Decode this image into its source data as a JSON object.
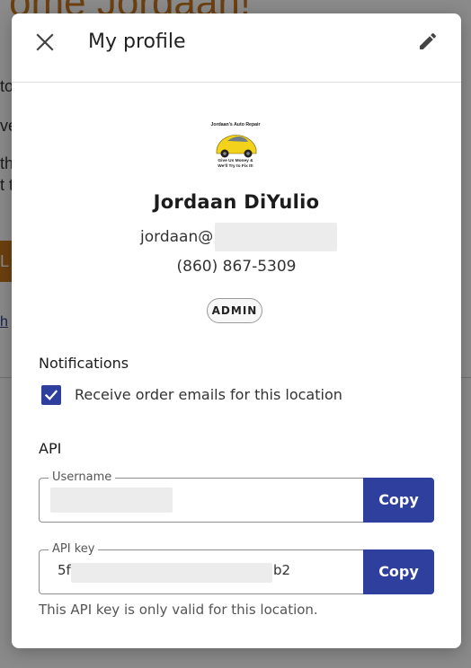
{
  "background": {
    "title": "ome Jordaan!",
    "lines": [
      "to",
      "ve",
      "th",
      "t t"
    ],
    "button_text": "L",
    "link_text": "h"
  },
  "modal": {
    "title": "My profile",
    "close_icon": "close-icon",
    "edit_icon": "pencil-icon"
  },
  "profile": {
    "logo": {
      "line1": "Jordaan's Auto Repair",
      "line2": "Give Us Money &",
      "line3": "We'll Try to Fix It!"
    },
    "name": "Jordaan DiYulio",
    "email_prefix": "jordaan@",
    "phone": "(860) 867-5309",
    "role_badge": "ADMIN"
  },
  "notifications": {
    "heading": "Notifications",
    "order_emails_label": "Receive order emails for this location",
    "order_emails_checked": true
  },
  "api": {
    "heading": "API",
    "username": {
      "label": "Username",
      "copy_label": "Copy"
    },
    "api_key": {
      "label": "API key",
      "prefix": "5f",
      "suffix": "b2",
      "copy_label": "Copy"
    },
    "helper_text": "This API key is only valid for this location."
  },
  "colors": {
    "accent": "#2f3f9e",
    "background_accent": "#c8761f"
  }
}
